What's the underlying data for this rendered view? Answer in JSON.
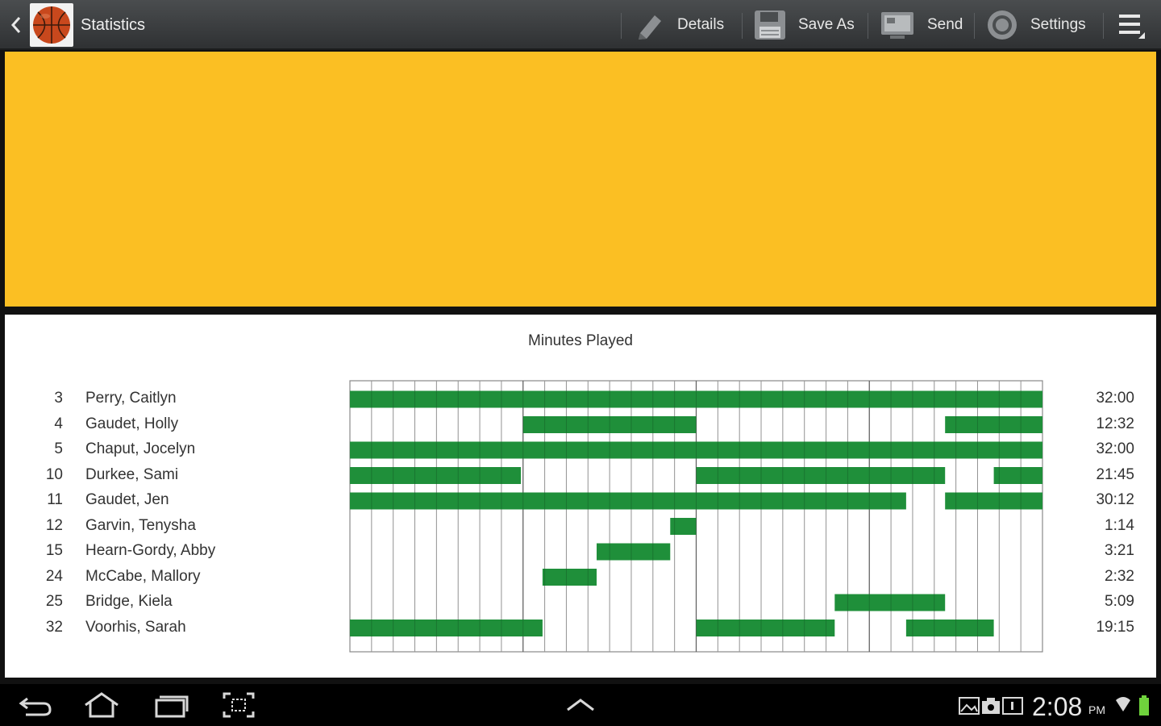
{
  "app": {
    "title": "Statistics"
  },
  "toolbar": {
    "details_label": "Details",
    "save_as_label": "Save As",
    "send_label": "Send",
    "settings_label": "Settings"
  },
  "colors": {
    "accent_panel": "#fbbf23",
    "bar": "#1f8f3a",
    "actionbar": "#3b3e40"
  },
  "chart_data": {
    "type": "gantt",
    "title": "Minutes Played",
    "xlim": [
      0,
      32
    ],
    "x_unit": "minutes",
    "rows": [
      {
        "number": "3",
        "name": "Perry, Caitlyn",
        "total": "32:00",
        "stints": [
          [
            0,
            32
          ]
        ]
      },
      {
        "number": "4",
        "name": "Gaudet, Holly",
        "total": "12:32",
        "stints": [
          [
            8,
            16
          ],
          [
            27.5,
            32
          ]
        ]
      },
      {
        "number": "5",
        "name": "Chaput, Jocelyn",
        "total": "32:00",
        "stints": [
          [
            0,
            32
          ]
        ]
      },
      {
        "number": "10",
        "name": "Durkee, Sami",
        "total": "21:45",
        "stints": [
          [
            0,
            7.9
          ],
          [
            16,
            27.5
          ],
          [
            29.75,
            32
          ]
        ]
      },
      {
        "number": "11",
        "name": "Gaudet, Jen",
        "total": "30:12",
        "stints": [
          [
            0,
            25.7
          ],
          [
            27.5,
            32
          ]
        ]
      },
      {
        "number": "12",
        "name": "Garvin, Tenysha",
        "total": "1:14",
        "stints": [
          [
            14.8,
            16
          ]
        ]
      },
      {
        "number": "15",
        "name": "Hearn-Gordy, Abby",
        "total": "3:21",
        "stints": [
          [
            11.4,
            14.8
          ]
        ]
      },
      {
        "number": "24",
        "name": "McCabe, Mallory",
        "total": "2:32",
        "stints": [
          [
            8.9,
            11.4
          ]
        ]
      },
      {
        "number": "25",
        "name": "Bridge, Kiela",
        "total": "5:09",
        "stints": [
          [
            22.4,
            27.5
          ]
        ]
      },
      {
        "number": "32",
        "name": "Voorhis, Sarah",
        "total": "19:15",
        "stints": [
          [
            0,
            8.9
          ],
          [
            16,
            22.4
          ],
          [
            25.7,
            29.75
          ]
        ]
      }
    ]
  },
  "statusbar": {
    "time": "2:08",
    "ampm": "PM"
  }
}
